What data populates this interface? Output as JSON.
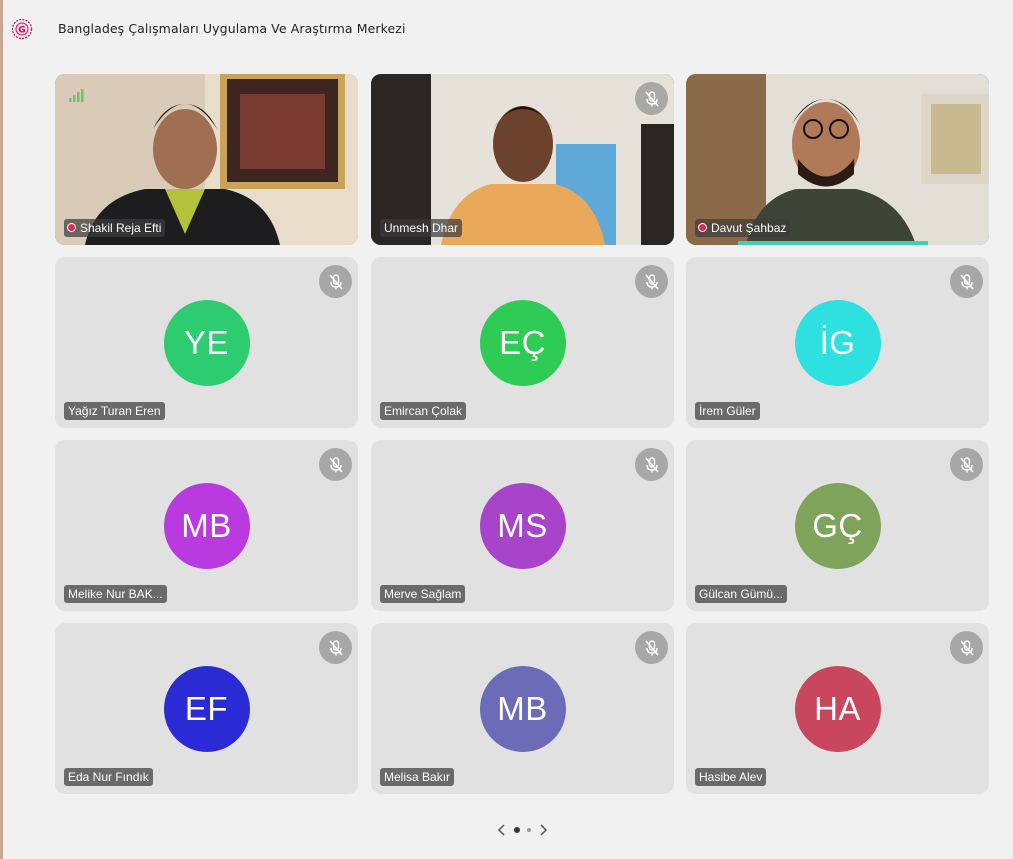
{
  "header": {
    "title": "Bangladeş Çalışmaları Uygulama Ve Araştırma Merkezi",
    "logo_icon": "org-logo-icon",
    "logo_color": "#c2185b"
  },
  "video_participants": [
    {
      "name": "Shakil Reja Efti",
      "recording": true,
      "muted": false
    },
    {
      "name": "Unmesh Dhar",
      "recording": false,
      "muted": true
    },
    {
      "name": "Davut Şahbaz",
      "recording": true,
      "muted": false,
      "speaking": true
    }
  ],
  "participants": [
    {
      "initials": "YE",
      "name": "Yağız Turan Eren",
      "color": "#2ecc71"
    },
    {
      "initials": "EÇ",
      "name": "Emircan Çolak",
      "color": "#2ecc55"
    },
    {
      "initials": "İG",
      "name": "İrem Güler",
      "color": "#2ee0e0"
    },
    {
      "initials": "MB",
      "name": "Melike Nur BAK...",
      "color": "#b93be0"
    },
    {
      "initials": "MS",
      "name": "Merve Sağlam",
      "color": "#a844c9"
    },
    {
      "initials": "GÇ",
      "name": "Gülcan Gümü...",
      "color": "#7ea35a"
    },
    {
      "initials": "EF",
      "name": "Eda Nur Fındık",
      "color": "#2b2bd6"
    },
    {
      "initials": "MB",
      "name": "Melisa Bakır",
      "color": "#6b6bb8"
    },
    {
      "initials": "HA",
      "name": "Hasibe Alev",
      "color": "#c8465e"
    }
  ],
  "pager": {
    "prev_icon": "chevron-left-icon",
    "next_icon": "chevron-right-icon",
    "pages": 2,
    "current_page": 1
  }
}
